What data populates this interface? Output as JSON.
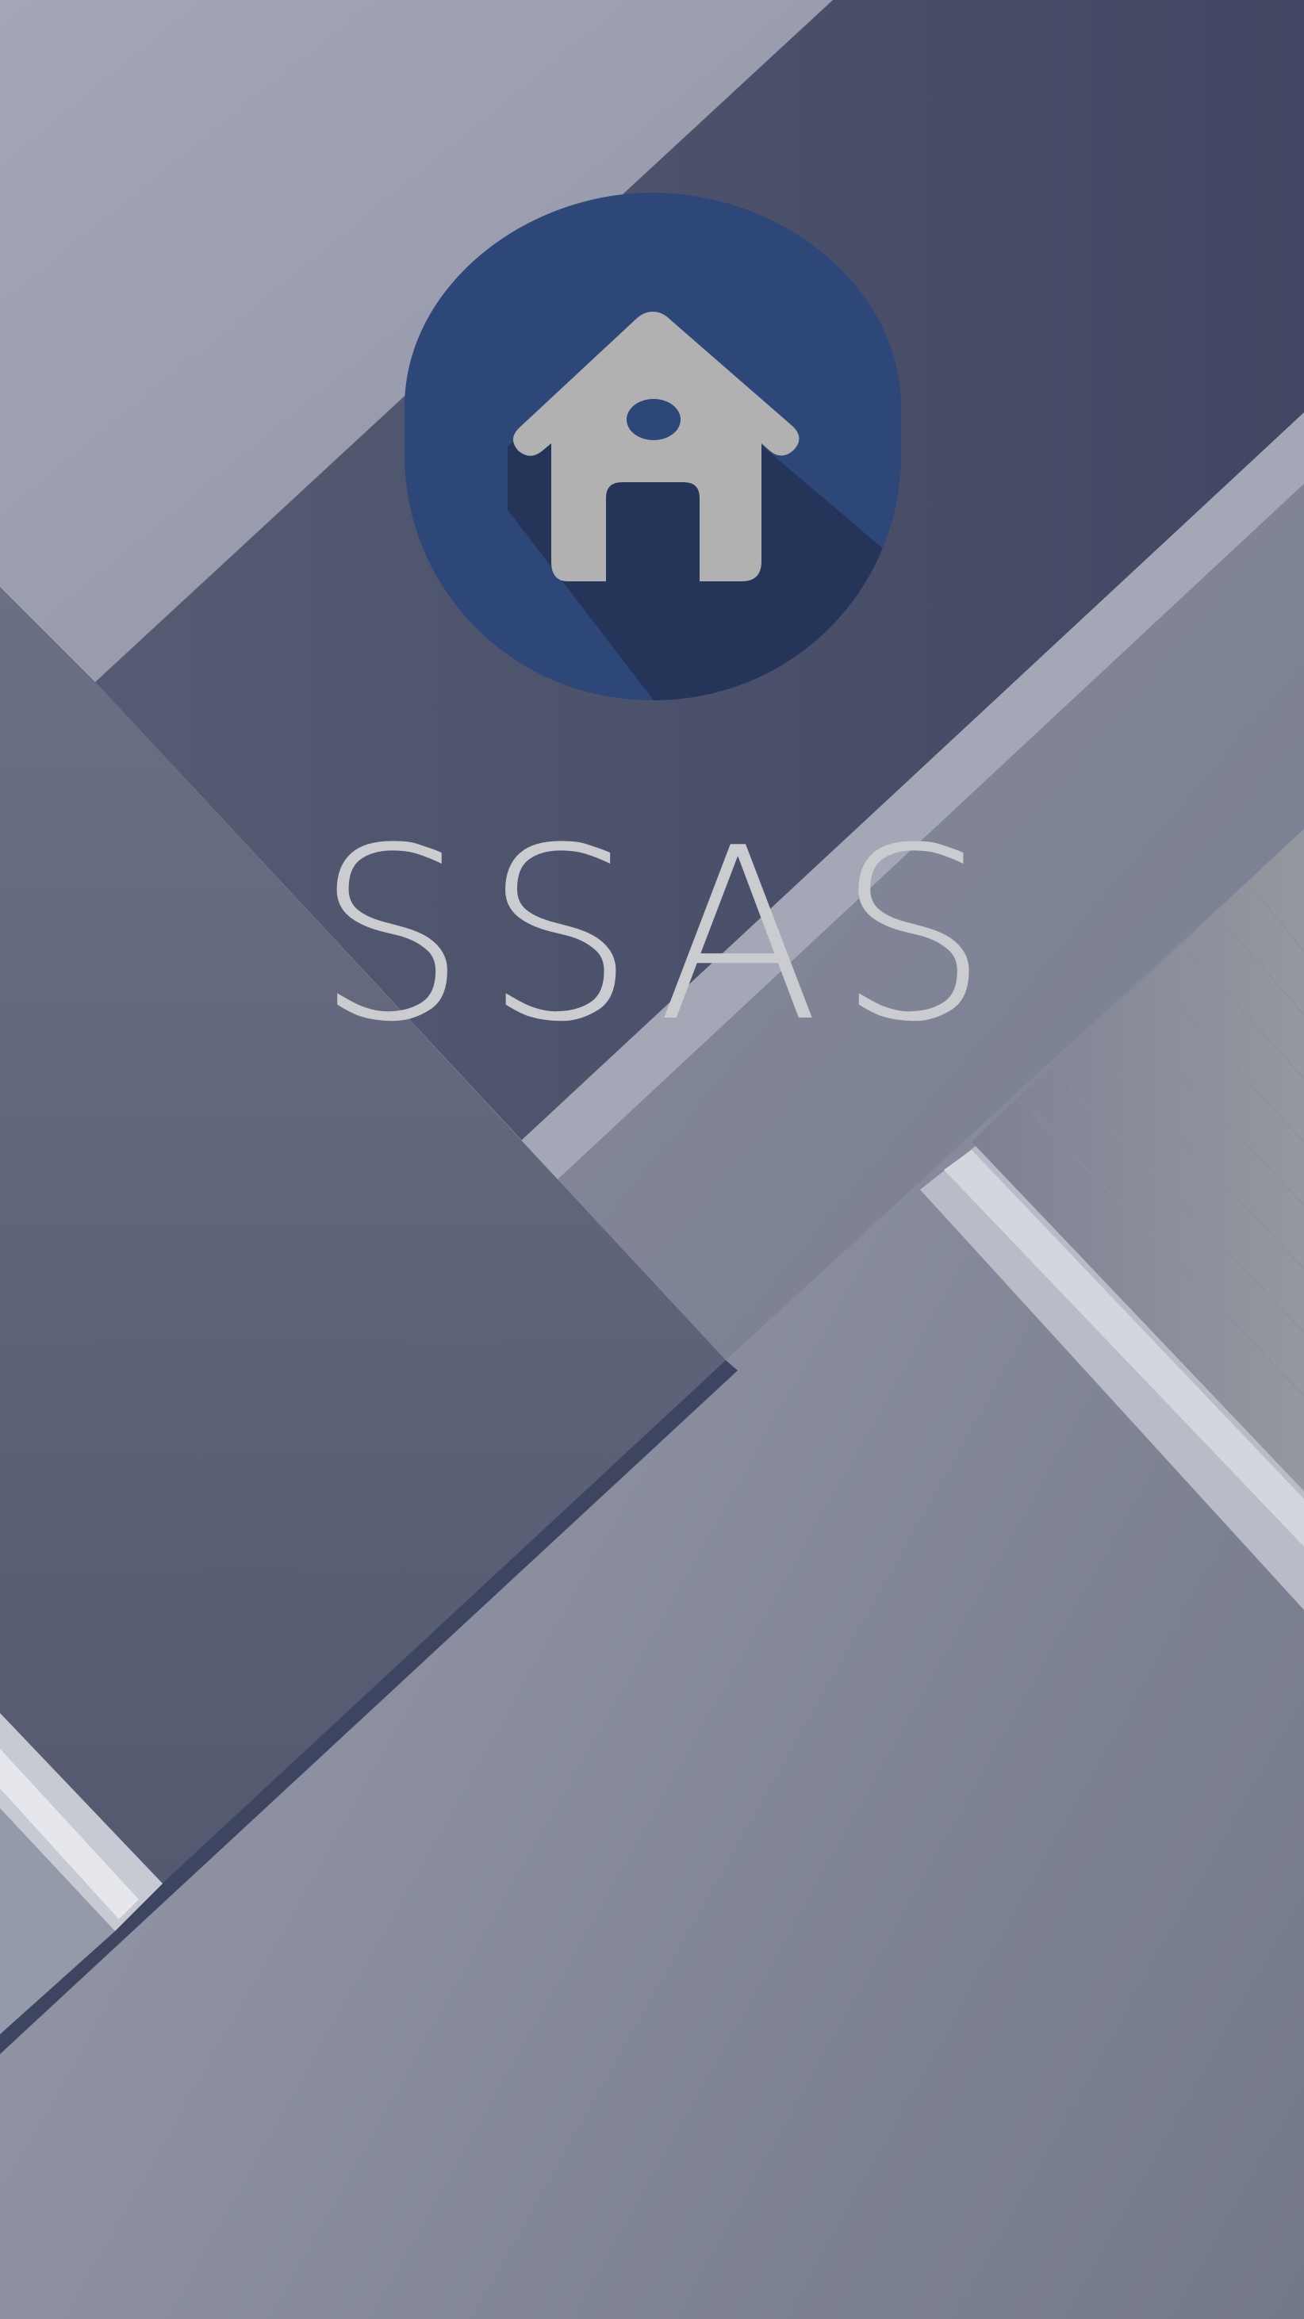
{
  "app": {
    "title": "SSAS",
    "logo_icon": "home-icon"
  },
  "colors": {
    "badge": "#2d4778",
    "badge_shadow": "#25355a",
    "house": "#b1b1b2",
    "title_text": "#cbccd0",
    "bg_light": "#9a9ead",
    "bg_dark_band": "#474d66",
    "bg_mid_panel": "#5f6479"
  }
}
